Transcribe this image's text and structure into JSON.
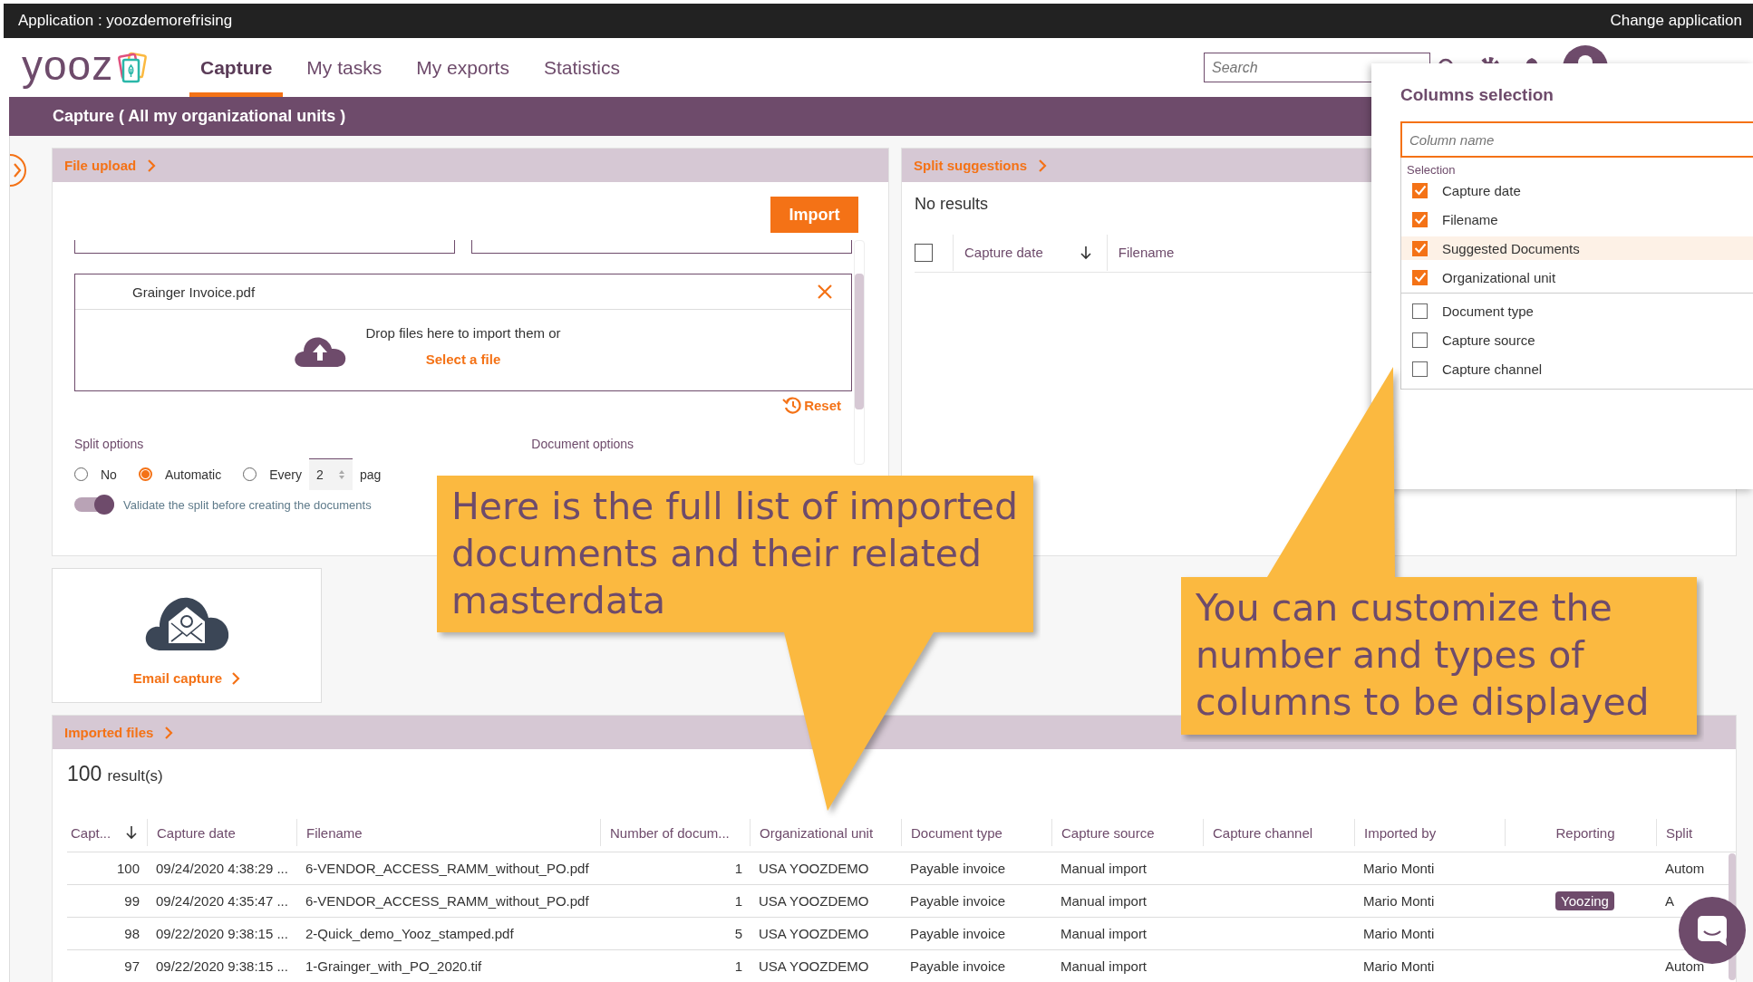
{
  "app_bar": {
    "title": "Application : yoozdemorefrising",
    "action": "Change application"
  },
  "nav": {
    "logo": "yooz",
    "tabs": [
      {
        "label": "Capture",
        "selected": true
      },
      {
        "label": "My tasks",
        "selected": false
      },
      {
        "label": "My exports",
        "selected": false
      },
      {
        "label": "Statistics",
        "selected": false
      }
    ],
    "search_placeholder": "Search"
  },
  "page_title": "Capture ( All my organizational units )",
  "file_upload": {
    "title": "File upload",
    "import_button": "Import",
    "file": "Grainger Invoice.pdf",
    "drop_text": "Drop files here to import them or",
    "select_link": "Select a file",
    "reset": "Reset",
    "split_label": "Split options",
    "split_options": [
      {
        "label": "No",
        "selected": false
      },
      {
        "label": "Automatic",
        "selected": true
      },
      {
        "label": "Every",
        "selected": false
      }
    ],
    "every_value": "2",
    "pages_text": "pag",
    "document_options": "Document options",
    "validate": {
      "label": "Validate the split before creating the documents",
      "on": true
    }
  },
  "split_suggestions": {
    "title": "Split suggestions",
    "empty": "No results",
    "select_all_checked": false,
    "columns": [
      {
        "label": "Capture date",
        "sorted": true
      },
      {
        "label": "Filename",
        "sorted": false
      }
    ]
  },
  "email_capture": {
    "label": "Email capture"
  },
  "imported_files": {
    "title": "Imported files",
    "count": "100",
    "count_label": "result(s)",
    "columns": [
      {
        "label": "Capt...",
        "sorted": true
      },
      {
        "label": "Capture date",
        "sorted": false
      },
      {
        "label": "Filename",
        "sorted": false
      },
      {
        "label": "Number of docum...",
        "sorted": false
      },
      {
        "label": "Organizational unit",
        "sorted": false
      },
      {
        "label": "Document type",
        "sorted": false
      },
      {
        "label": "Capture source",
        "sorted": false
      },
      {
        "label": "Capture channel",
        "sorted": false
      },
      {
        "label": "Imported by",
        "sorted": false
      },
      {
        "label": "Reporting",
        "sorted": false
      },
      {
        "label": "Split",
        "sorted": false
      }
    ],
    "rows": [
      {
        "id": "100",
        "capture_date": "09/24/2020 4:38:29 ...",
        "filename": "6-VENDOR_ACCESS_RAMM_without_PO.pdf",
        "documents": "1",
        "org_unit": "USA YOOZDEMO",
        "doc_type": "Payable invoice",
        "source": "Manual import",
        "imported_by": "Mario Monti",
        "split": "Autom"
      },
      {
        "id": "99",
        "capture_date": "09/24/2020 4:35:47 ...",
        "filename": "6-VENDOR_ACCESS_RAMM_without_PO.pdf",
        "documents": "1",
        "org_unit": "USA YOOZDEMO",
        "doc_type": "Payable invoice",
        "source": "Manual import",
        "imported_by": "Mario Monti",
        "reporting": "Yoozing",
        "split": "A"
      },
      {
        "id": "98",
        "capture_date": "09/22/2020 9:38:15 ...",
        "filename": "2-Quick_demo_Yooz_stamped.pdf",
        "documents": "5",
        "org_unit": "USA YOOZDEMO",
        "doc_type": "Payable invoice",
        "source": "Manual import",
        "imported_by": "Mario Monti"
      },
      {
        "id": "97",
        "capture_date": "09/22/2020 9:38:15 ...",
        "filename": "1-Grainger_with_PO_2020.tif",
        "documents": "1",
        "org_unit": "USA YOOZDEMO",
        "doc_type": "Payable invoice",
        "source": "Manual import",
        "imported_by": "Mario Monti",
        "split": "Autom"
      }
    ]
  },
  "columns_selection": {
    "title": "Columns selection",
    "placeholder": "Column name",
    "section": "Selection",
    "items": [
      {
        "label": "Capture date",
        "checked": true,
        "highlighted": false
      },
      {
        "label": "Filename",
        "checked": true,
        "highlighted": false
      },
      {
        "label": "Suggested Documents",
        "checked": true,
        "highlighted": true
      },
      {
        "label": "Organizational unit",
        "checked": true,
        "highlighted": false
      },
      {
        "label": "Document type",
        "checked": false,
        "highlighted": false
      },
      {
        "label": "Capture source",
        "checked": false,
        "highlighted": false
      },
      {
        "label": "Capture channel",
        "checked": false,
        "highlighted": false
      }
    ]
  },
  "callouts": [
    {
      "text": "Here is the full list of imported documents and their related masterdata"
    },
    {
      "text": "You can customize the number and types of columns to be displayed"
    }
  ]
}
